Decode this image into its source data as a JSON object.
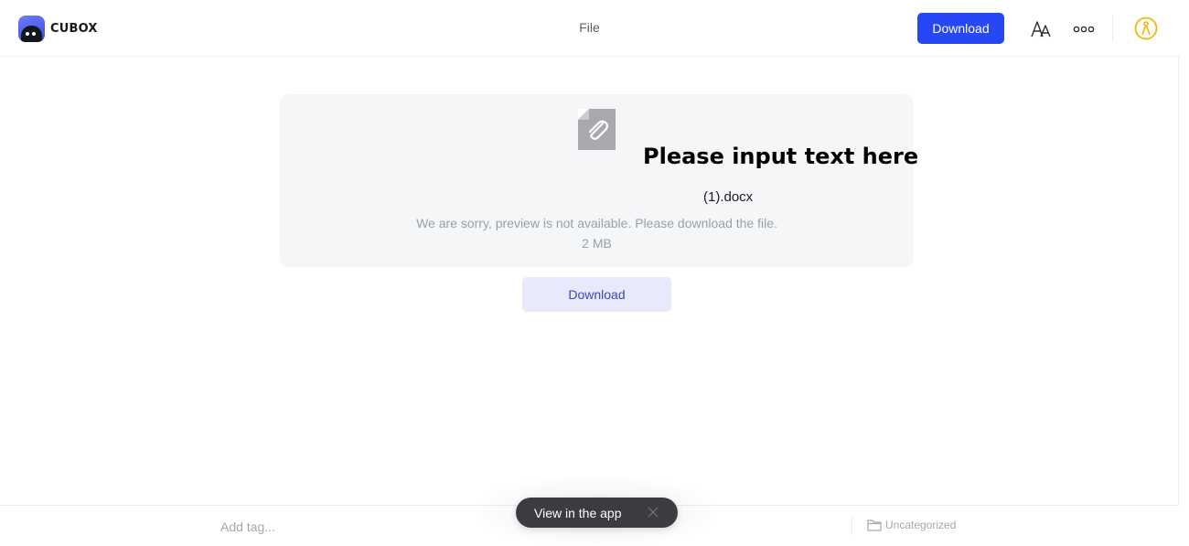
{
  "app": {
    "name": "CUBOX"
  },
  "header": {
    "title": "File",
    "download_label": "Download",
    "icons": {
      "font": "font-size-icon",
      "more": "more-dots-icon",
      "account": "account-icon"
    }
  },
  "preview": {
    "overlay_text": "Please input text here",
    "file_name": "(1).docx",
    "message": "We are sorry, preview is not available. Please download the file.",
    "size": "2 MB",
    "download_label": "Download",
    "icon": "paperclip-file-icon"
  },
  "footer": {
    "tag_placeholder": "Add tag...",
    "folder_label": "Uncategorized"
  },
  "toast": {
    "label": "View in the app"
  },
  "colors": {
    "primary": "#2747f5",
    "secondary_bg": "#e8eafc",
    "account": "#f2b705",
    "toast_bg": "#3b3c3f"
  }
}
